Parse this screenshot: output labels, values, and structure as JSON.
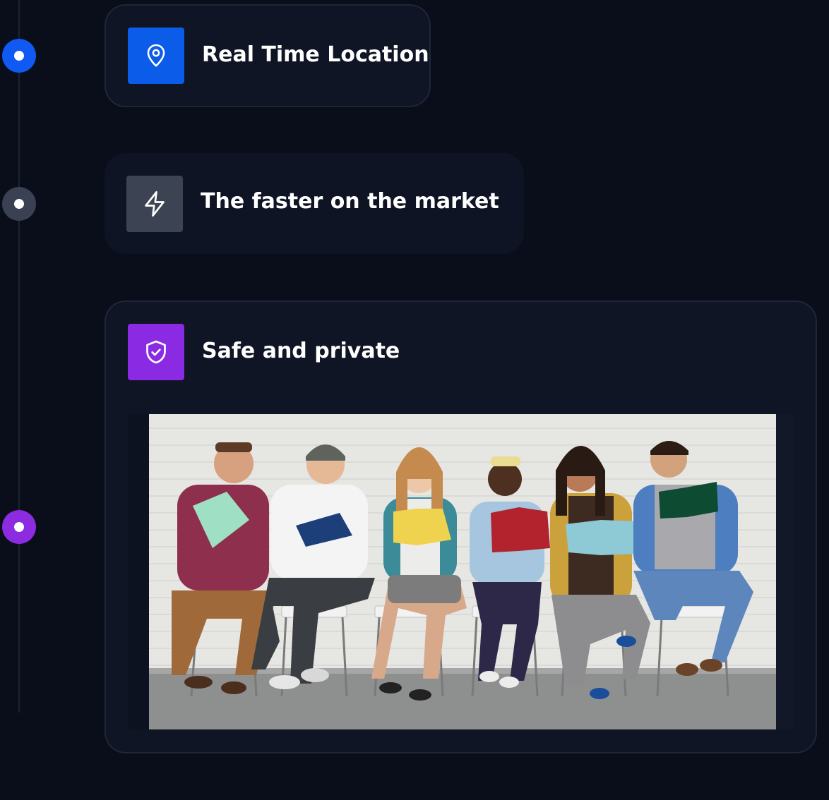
{
  "features": [
    {
      "title": "Real Time Location",
      "icon": "map-pin-icon",
      "accent": "#0b5ce8",
      "dot_color": "#1059f2"
    },
    {
      "title": "The faster on the market",
      "icon": "lightning-icon",
      "accent": "#3c4453",
      "dot_color": "#394152"
    },
    {
      "title": "Safe and private",
      "icon": "shield-check-icon",
      "accent": "#8a2ae3",
      "dot_color": "#8c2be0"
    }
  ],
  "image": {
    "subject": "six-people-reading-books-photo"
  }
}
